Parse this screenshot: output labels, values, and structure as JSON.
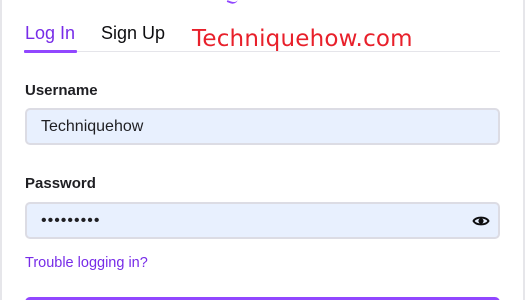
{
  "tabs": {
    "login_label": "Log In",
    "signup_label": "Sign Up"
  },
  "watermark": "Techniquehow.com",
  "form": {
    "username_label": "Username",
    "username_value": "Techniquehow",
    "password_label": "Password",
    "password_value": "•••••••••",
    "trouble_link": "Trouble logging in?"
  },
  "icons": {
    "password_toggle": "eye-icon"
  },
  "colors": {
    "accent": "#9147ff",
    "link": "#772ce8",
    "input_bg": "#e8f0fe",
    "watermark": "#e8202b"
  }
}
